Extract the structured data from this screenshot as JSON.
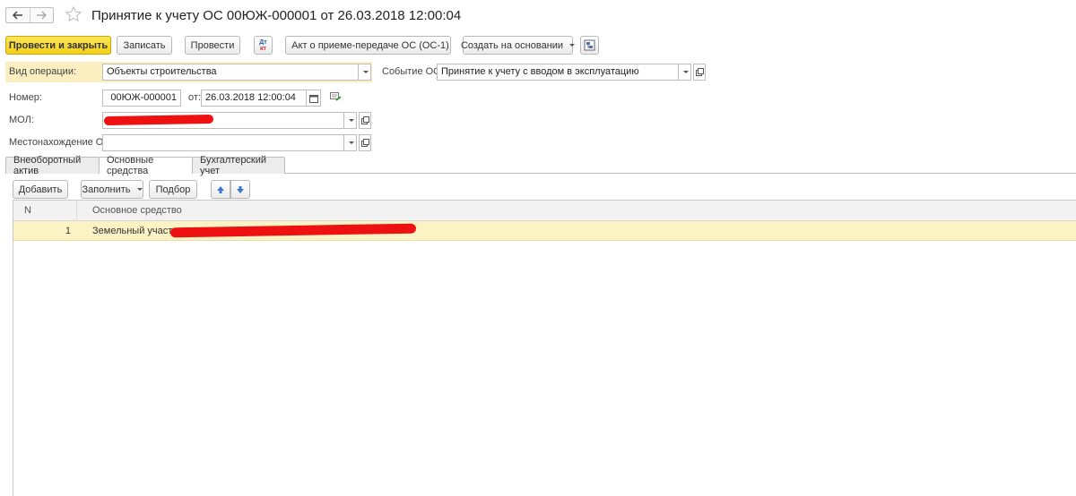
{
  "window": {
    "title": "Принятие к учету ОС 00ЮЖ-000001 от 26.03.2018 12:00:04"
  },
  "toolbar": {
    "post_close": "Провести и закрыть",
    "save": "Записать",
    "post": "Провести",
    "dt_kt_top": "Дт",
    "dt_kt_bottom": "кт",
    "print_act": "Акт о приеме-передаче ОС (ОС-1)",
    "create_based": "Создать на основании"
  },
  "form": {
    "operation_label": "Вид операции:",
    "operation_value": "Объекты строительства",
    "event_label": "Событие ОС:",
    "event_value": "Принятие к учету с вводом в эксплуатацию",
    "number_label": "Номер:",
    "number_value": "00ЮЖ-000001",
    "date_label": "от:",
    "date_value": "26.03.2018 12:00:04",
    "mol_label": "МОЛ:",
    "mol_value": "",
    "location_label": "Местонахождение ОС:",
    "location_value": ""
  },
  "tabs": [
    {
      "label": "Внеоборотный актив"
    },
    {
      "label": "Основные средства"
    },
    {
      "label": "Бухгалтерский учет"
    }
  ],
  "table_toolbar": {
    "add": "Добавить",
    "fill": "Заполнить",
    "select": "Подбор"
  },
  "table": {
    "columns": [
      "N",
      "Основное средство"
    ],
    "rows": [
      {
        "n": "1",
        "asset": "Земельный участок"
      }
    ]
  },
  "colors": {
    "primary_button": "#f2cf18",
    "highlight": "#fbefc2",
    "selected_row": "#fbf3c4",
    "redaction": "#ee1111"
  }
}
